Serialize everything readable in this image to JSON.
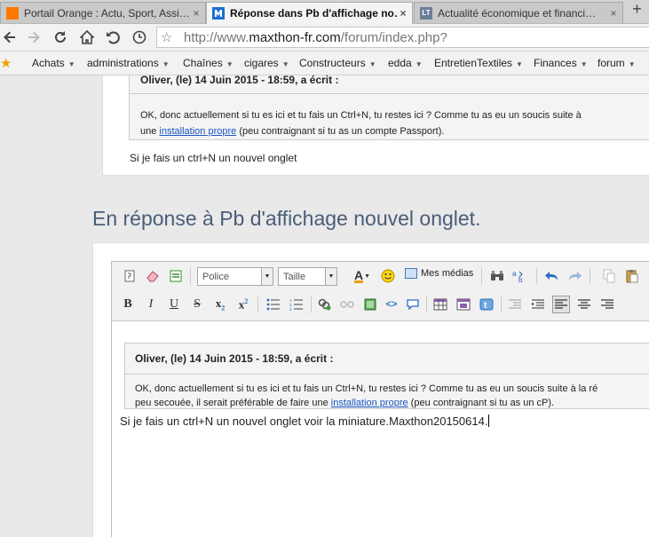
{
  "tabs": [
    {
      "title": "Portail Orange : Actu, Sport, Assi…",
      "favicon": "orange-portal-icon",
      "active": false
    },
    {
      "title": "Réponse dans Pb d'affichage no…",
      "favicon": "maxthon-icon",
      "active": true
    },
    {
      "title": "Actualité économique et financi…",
      "favicon": "lt-icon",
      "active": false
    }
  ],
  "tab_close_glyph": "×",
  "new_tab_glyph": "+",
  "address": {
    "prefix": "http://www.",
    "domain": "maxthon-fr.com",
    "path": "/forum/index.php?"
  },
  "bookmarks": [
    "Achats",
    "administrations",
    "Chaînes",
    "cigares",
    "Constructeurs",
    "edda",
    "EntretienTextiles",
    "Finances",
    "forum"
  ],
  "quoted_post": {
    "header": "Oliver, (le) 14 Juin 2015 - 18:59, a écrit :",
    "line1": "OK, donc actuellement si tu es ici et tu fais un Ctrl+N, tu restes ici ? Comme tu as eu un soucis suite à",
    "line2_prefix": "une ",
    "link": "installation propre",
    "line2_suffix": " (peu contraignant si tu as un compte Passport)."
  },
  "reply_text": "Si je fais un ctrl+N un nouvel onglet",
  "reply_title": "En réponse à Pb d'affichage nouvel onglet.",
  "editor": {
    "font_placeholder": "Police",
    "size_placeholder": "Taille",
    "mes_medias": "Mes médias",
    "quote_header": "Oliver, (le) 14 Juin 2015 - 18:59, a écrit :",
    "quote_line1": "OK, donc actuellement si tu es ici et tu fais un Ctrl+N, tu restes ici ? Comme tu as eu un soucis suite à la ré",
    "quote_line2_prefix": "peu secouée, il serait préférable de faire une ",
    "quote_link": "installation propre",
    "quote_line2_suffix": " (peu contraignant si tu as un cP).",
    "body_text": "Si je fais un ctrl+N un nouvel onglet voir la miniature.Maxthon20150614."
  }
}
